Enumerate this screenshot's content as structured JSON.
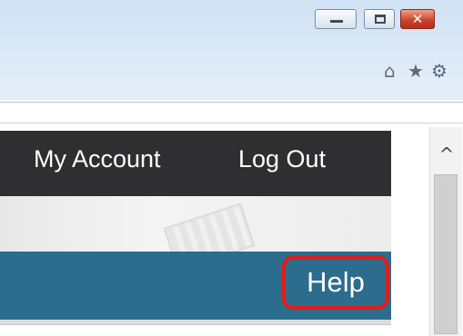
{
  "window_controls": {
    "minimize_icon": "minimize-icon",
    "maximize_icon": "maximize-icon",
    "close_icon": "close-icon",
    "close_glyph": "✕"
  },
  "toolbar": {
    "home_glyph": "⌂",
    "favorites_glyph": "★",
    "tools_glyph": "⚙"
  },
  "nav": {
    "my_account": "My Account",
    "log_out": "Log Out"
  },
  "help": {
    "label": "Help",
    "highlight_color": "#e51a1a"
  },
  "scrollbar": {
    "up_glyph": "^"
  },
  "colors": {
    "nav_bg": "#2f2f31",
    "bar_bg": "#2c6c8c"
  }
}
